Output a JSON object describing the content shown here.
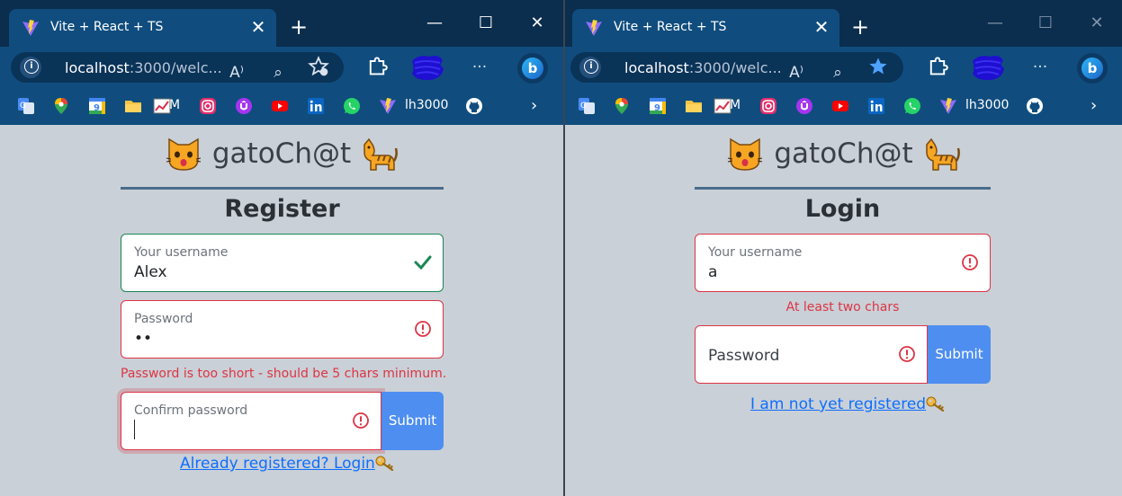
{
  "browser": {
    "tab_title": "Vite + React + TS",
    "tab_close": "✕",
    "new_tab": "+",
    "url_host": "localhost",
    "url_rest": ":3000/welc...",
    "read_aloud_glyph": "A⁾",
    "zoom_glyph": "⌕",
    "more_glyph": "···",
    "bing_glyph": "b",
    "window_controls": {
      "minimize": "—",
      "maximize": "☐",
      "close": "✕"
    },
    "bookmarks": [
      {
        "icon": "google-translate-icon"
      },
      {
        "icon": "google-maps-icon"
      },
      {
        "icon": "google-calendar-icon"
      },
      {
        "icon": "folder-icon"
      },
      {
        "icon": "chart-icon",
        "label": "M"
      },
      {
        "icon": "instagram-icon"
      },
      {
        "icon": "udemy-icon"
      },
      {
        "icon": "youtube-icon"
      },
      {
        "icon": "linkedin-icon"
      },
      {
        "icon": "whatsapp-icon"
      },
      {
        "icon": "vite-icon",
        "label": "lh3000"
      },
      {
        "icon": "github-icon"
      }
    ],
    "bookmarks_overflow": "›"
  },
  "app": {
    "title": "gatoCh@t"
  },
  "register": {
    "heading": "Register",
    "username_label": "Your username",
    "username_value": "Alex",
    "password_label": "Password",
    "password_value": "••",
    "password_error": "Password is too short - should be 5 chars minimum.",
    "confirm_label": "Confirm password",
    "submit_label": "Submit",
    "login_link": "Already registered? Login"
  },
  "login": {
    "heading": "Login",
    "username_label": "Your username",
    "username_value": "a",
    "username_error": "At least two chars",
    "password_placeholder": "Password",
    "submit_label": "Submit",
    "register_link": "I am not yet registered"
  },
  "colors": {
    "page_bg": "#cad0d7",
    "chrome": "#104d7e",
    "valid": "#198754",
    "invalid": "#dc3545",
    "submit": "#4e8ef0",
    "link": "#0d6efd"
  }
}
